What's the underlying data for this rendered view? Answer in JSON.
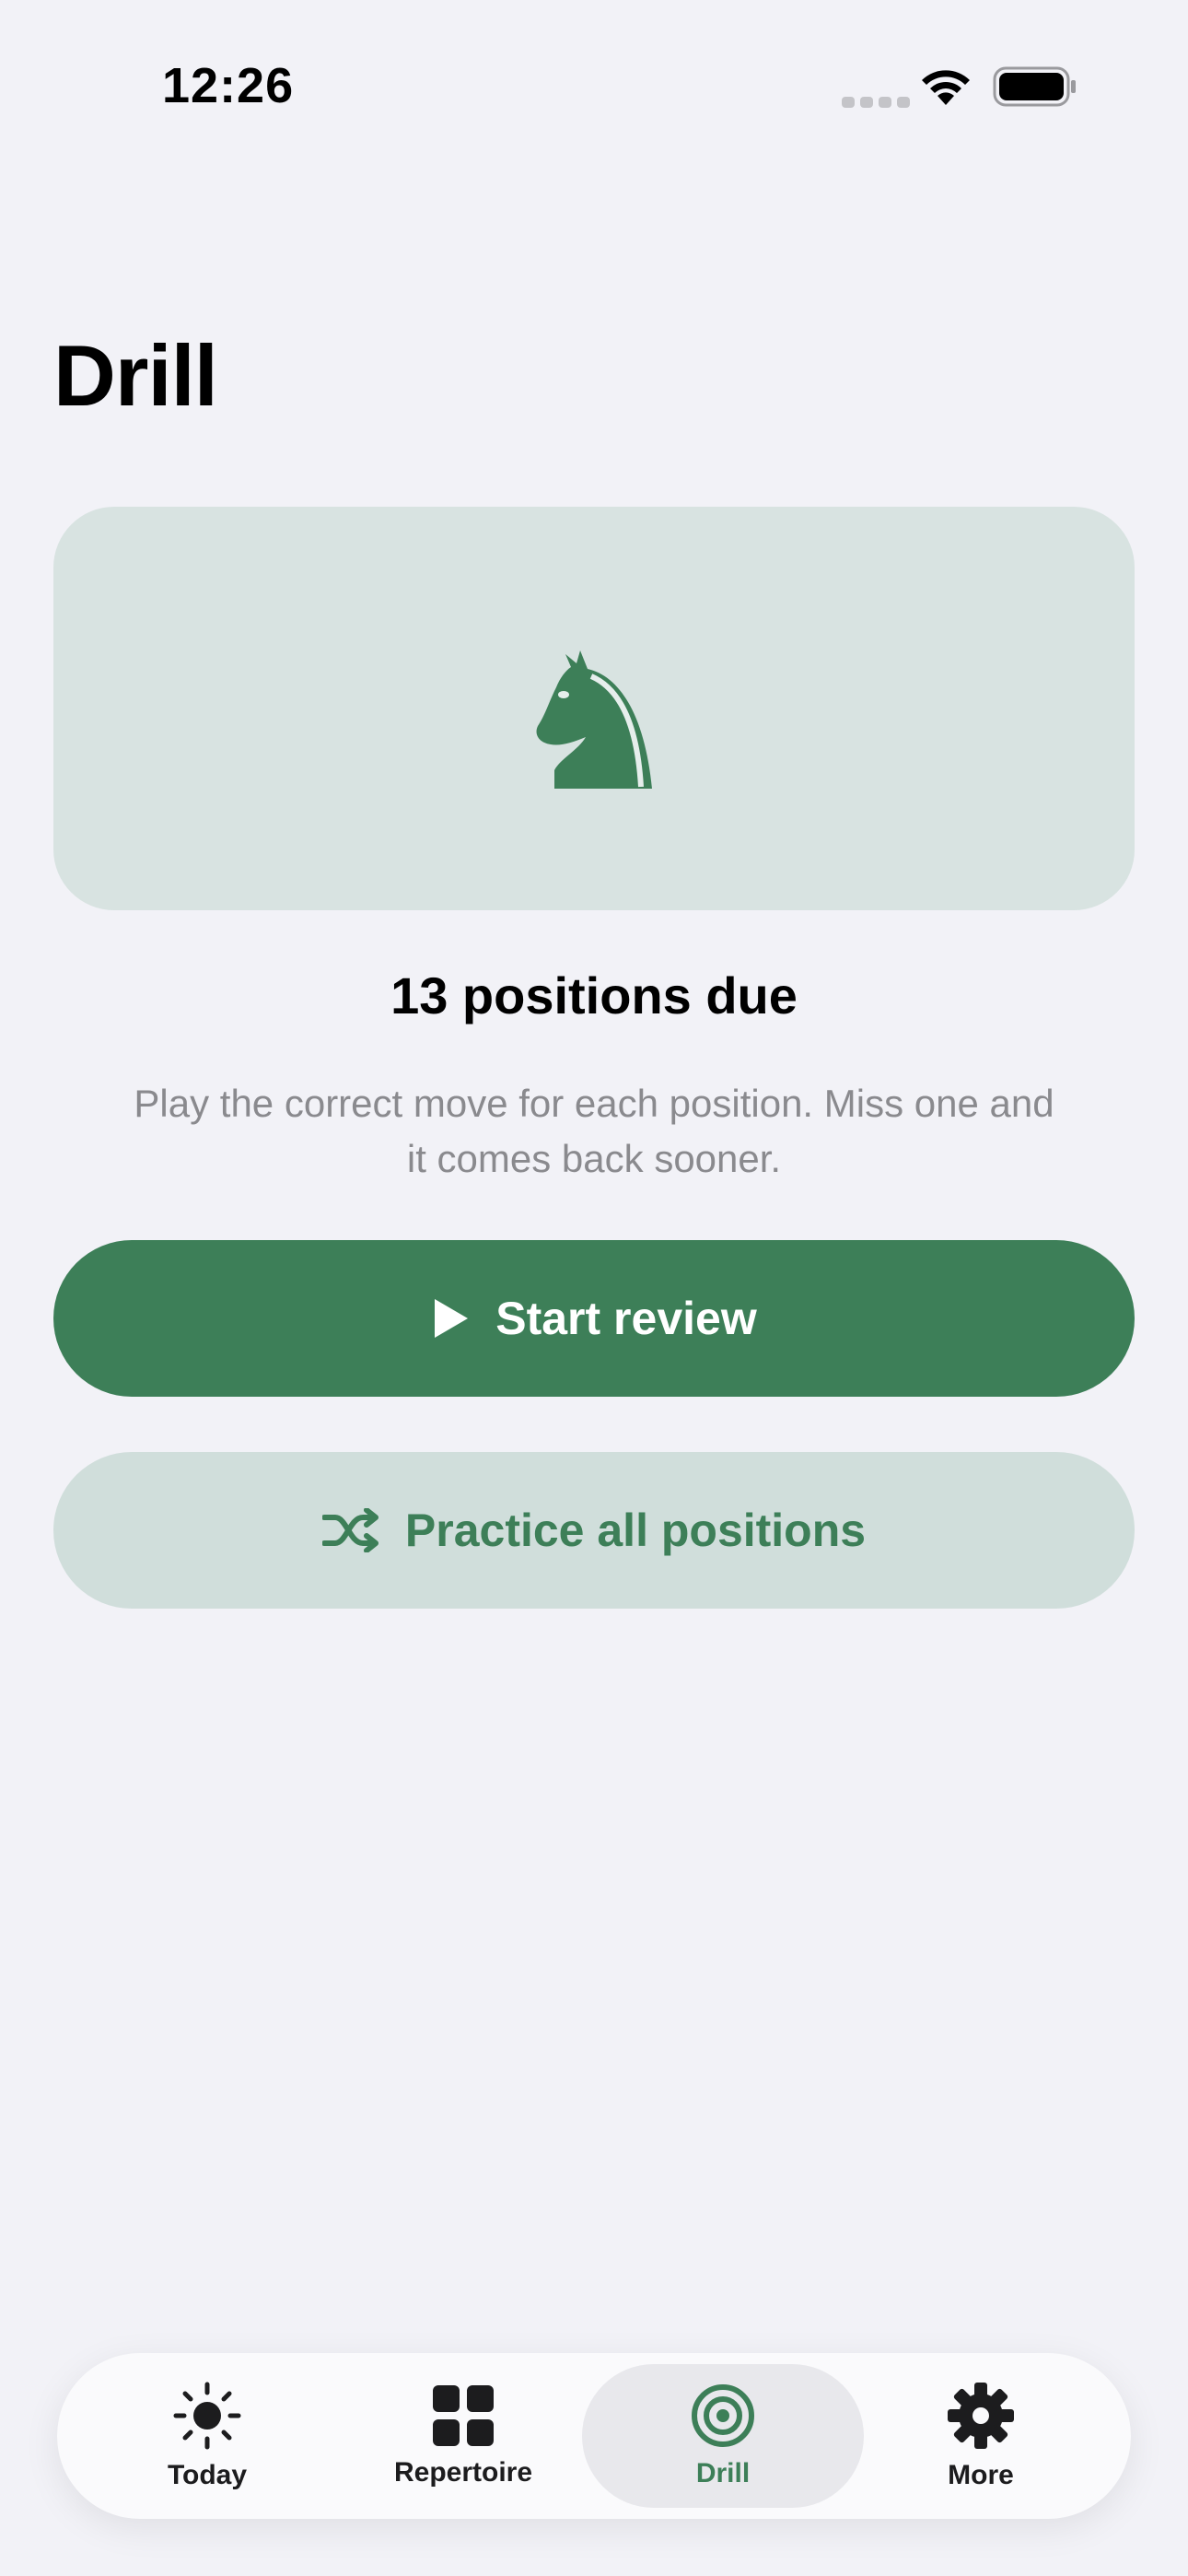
{
  "status_bar": {
    "time": "12:26"
  },
  "page": {
    "title": "Drill"
  },
  "hero": {
    "icon": "chess-knight-icon"
  },
  "summary": {
    "due_text": "13 positions due",
    "description": "Play the correct move for each position. Miss one and it comes back sooner."
  },
  "actions": {
    "start_label": "Start review",
    "practice_label": "Practice all positions"
  },
  "tab_bar": {
    "items": [
      {
        "label": "Today",
        "icon": "sun-icon"
      },
      {
        "label": "Repertoire",
        "icon": "grid-icon"
      },
      {
        "label": "Drill",
        "icon": "target-icon",
        "active": true
      },
      {
        "label": "More",
        "icon": "gear-icon"
      }
    ]
  },
  "colors": {
    "accent": "#3d7f58",
    "hero_bg": "#d8e3e1",
    "secondary_button_bg": "#d0dedb",
    "background": "#f2f2f7"
  }
}
